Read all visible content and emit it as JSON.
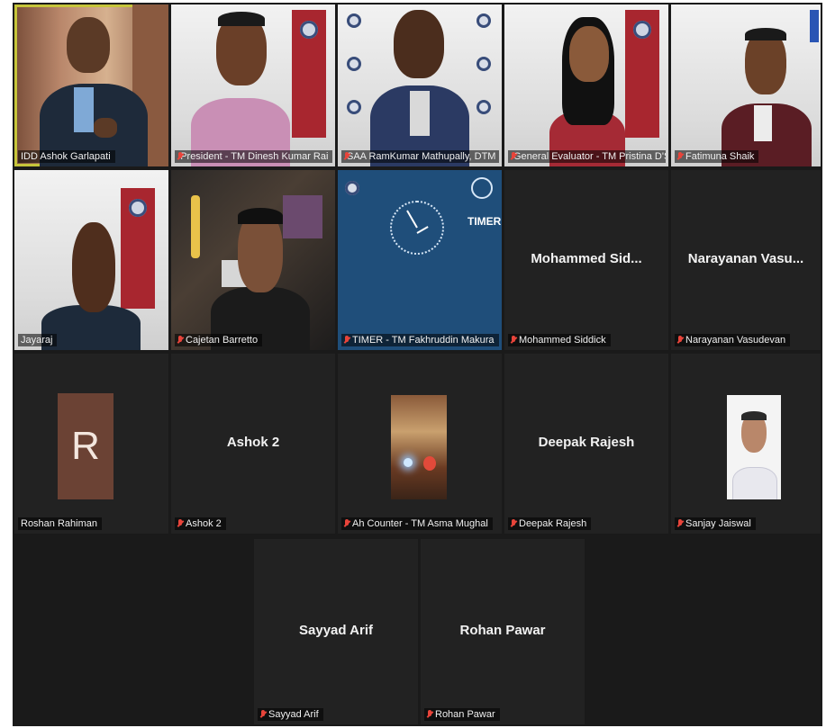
{
  "colors": {
    "tile_bg": "#222222",
    "active_border": "#c6c53a",
    "muted_mic": "#e8443a",
    "timer_bg": "#1f4e7a",
    "avatar_bg": "#6b4234"
  },
  "participants": [
    {
      "label": "IDD Ashok Garlapati",
      "has_video": true,
      "muted": false,
      "active_speaker": true
    },
    {
      "label": "President - TM Dinesh Kumar Rai",
      "has_video": true,
      "muted": true
    },
    {
      "label": "SAA RamKumar Mathupally, DTM",
      "has_video": true,
      "muted": true
    },
    {
      "label": "General Evaluator - TM Pristina D'Souza",
      "has_video": true,
      "muted": true
    },
    {
      "label": "Fatimuna Shaik",
      "has_video": true,
      "muted": true
    },
    {
      "label": "Jayaraj",
      "has_video": true,
      "muted": false
    },
    {
      "label": "Cajetan Barretto",
      "has_video": true,
      "muted": true
    },
    {
      "label": "TIMER - TM Fakhruddin Makura",
      "has_video": true,
      "muted": true,
      "timer_text": "TIMER"
    },
    {
      "label": "Mohammed Siddick",
      "display_name": "Mohammed Sid...",
      "has_video": false,
      "muted": true
    },
    {
      "label": "Narayanan Vasudevan",
      "display_name": "Narayanan Vasu...",
      "has_video": false,
      "muted": true
    },
    {
      "label": "Roshan Rahiman",
      "avatar_initial": "R",
      "has_video": false,
      "muted": false
    },
    {
      "label": "Ashok 2",
      "display_name": "Ashok 2",
      "has_video": false,
      "muted": true
    },
    {
      "label": "Ah Counter - TM Asma Mughal",
      "has_video": false,
      "muted": true,
      "photo": "candle-photo"
    },
    {
      "label": "Deepak Rajesh",
      "display_name": "Deepak Rajesh",
      "has_video": false,
      "muted": true
    },
    {
      "label": "Sanjay Jaiswal",
      "has_video": false,
      "muted": true,
      "photo": "portrait-photo"
    },
    {
      "label": "Sayyad Arif",
      "display_name": "Sayyad Arif",
      "has_video": false,
      "muted": true
    },
    {
      "label": "Rohan Pawar",
      "display_name": "Rohan Pawar",
      "has_video": false,
      "muted": true
    }
  ]
}
